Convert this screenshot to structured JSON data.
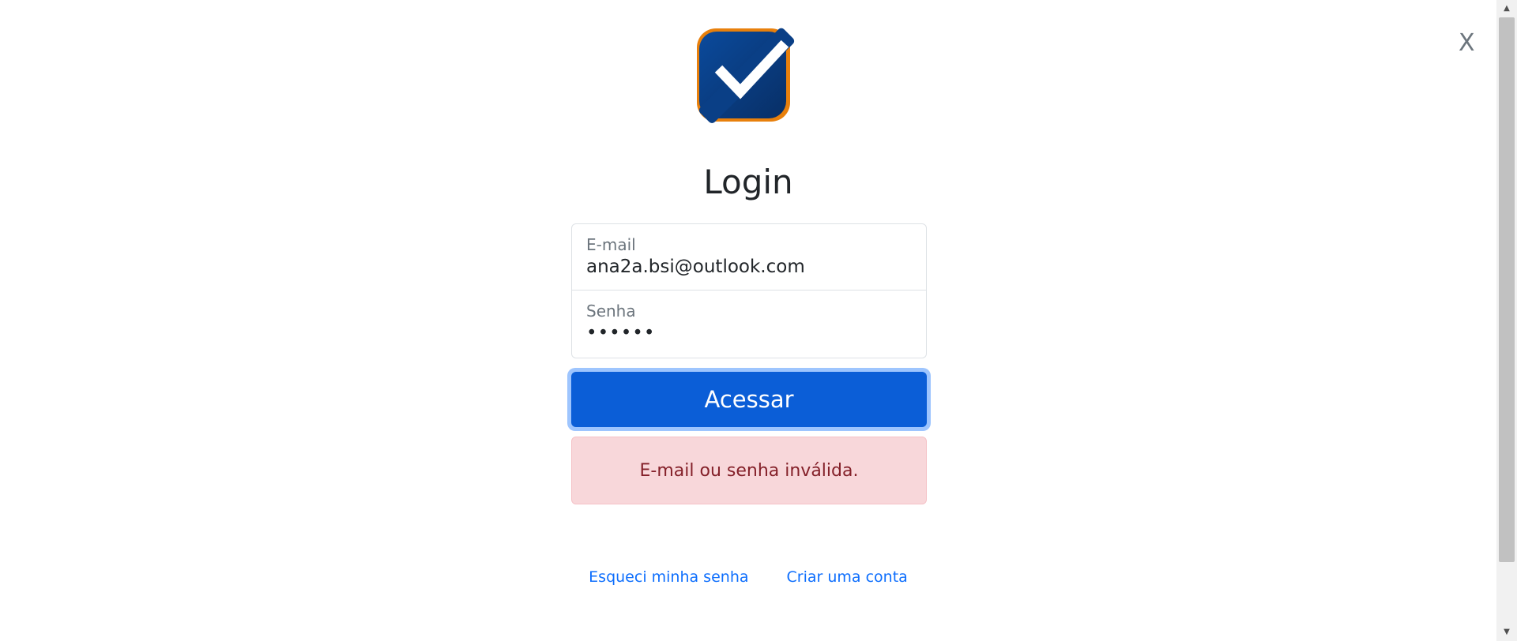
{
  "header": {
    "close_label": "X",
    "logo_icon": "checkmark-logo-icon"
  },
  "login": {
    "title": "Login",
    "email": {
      "label": "E-mail",
      "value": "ana2a.bsi@outlook.com"
    },
    "password": {
      "label": "Senha",
      "value": "••••••"
    },
    "submit_label": "Acessar",
    "error_message": "E-mail ou senha inválida."
  },
  "links": {
    "forgot_password": "Esqueci minha senha",
    "create_account": "Criar uma conta"
  },
  "colors": {
    "primary": "#0b5ed7",
    "link": "#0d6efd",
    "alert_bg": "#f8d7da",
    "alert_text": "#842029",
    "logo_blue": "#0a3f86",
    "logo_orange": "#e8800c"
  }
}
